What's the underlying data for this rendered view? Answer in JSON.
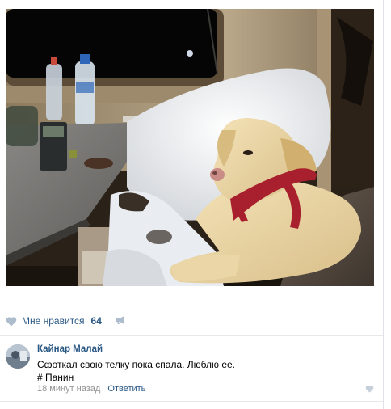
{
  "post": {
    "like_label": "Мне нравится",
    "like_count": "64"
  },
  "comment": {
    "author": "Кайнар Малай",
    "text_line1": "Сфоткал свою телку пока спала. Люблю ее.",
    "text_line2": "# Панин",
    "time": "18 минут назад",
    "reply_label": "Ответить"
  },
  "colors": {
    "link": "#2a5885",
    "icon": "#aebdcd",
    "muted": "#939393",
    "divider": "#e7e8ec"
  },
  "icons": {
    "like": "heart-icon",
    "share": "share-megaphone-icon",
    "comment_like": "heart-icon"
  }
}
